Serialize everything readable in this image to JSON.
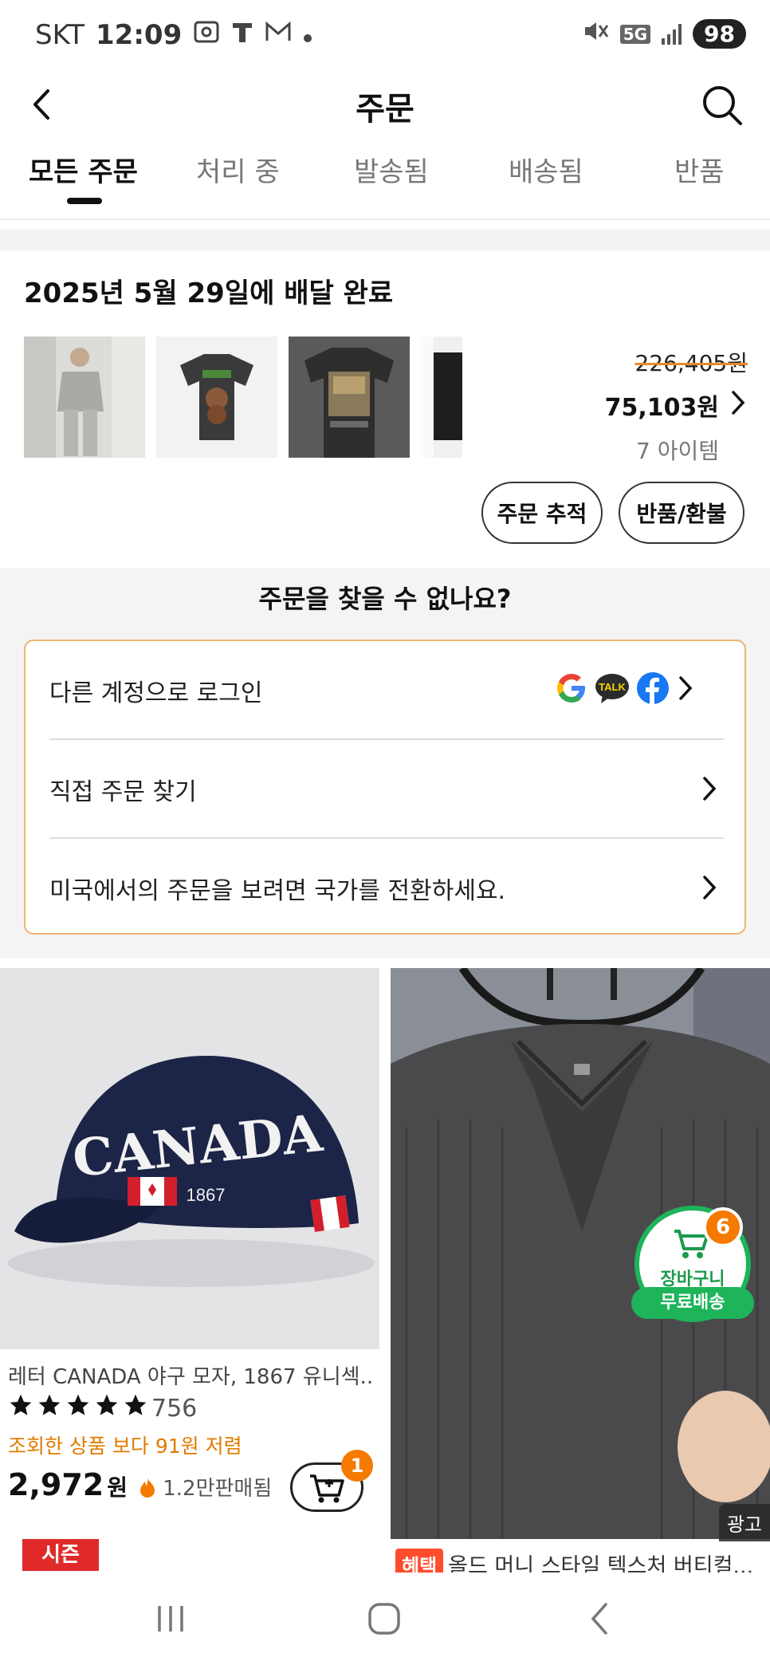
{
  "status_bar": {
    "carrier": "SKT",
    "time": "12:09",
    "network": "5G",
    "battery": "98"
  },
  "header": {
    "title": "주문"
  },
  "tabs": [
    {
      "label": "모든 주문",
      "active": true
    },
    {
      "label": "처리 중",
      "active": false
    },
    {
      "label": "발송됨",
      "active": false
    },
    {
      "label": "배송됨",
      "active": false
    },
    {
      "label": "반품",
      "active": false
    }
  ],
  "order": {
    "delivery_status": "2025년 5월 29일에 배달 완료",
    "original_price": "226,405원",
    "price": "75,103원",
    "item_count": "7 아이템",
    "track_button": "주문 추적",
    "return_button": "반품/환불"
  },
  "find_order": {
    "title": "주문을 찾을 수 없나요?",
    "rows": [
      {
        "label": "다른 계정으로 로그인"
      },
      {
        "label": "직접 주문 찾기"
      },
      {
        "label": "미국에서의 주문을 보려면 국가를 전환하세요."
      }
    ],
    "kakao_label": "TALK"
  },
  "products": {
    "left": {
      "name": "레터 CANADA 야구 모자, 1867 유니섹...",
      "rating_count": "756",
      "promo": "조회한 상품 보다 91원 저렴",
      "price": "2,972",
      "currency": "원",
      "sold": "1.2만판매됨",
      "cart_badge": "1",
      "hat_text": "CANADA",
      "hat_year": "1867",
      "season_tag": "시즌"
    },
    "right": {
      "ad_label": "광고",
      "deal_tag": "혜택",
      "name": "올드 머니 스타일 텍스처 버티컬..."
    }
  },
  "floating_cart": {
    "label": "장바구니",
    "badge": "6",
    "free_shipping": "무료배송"
  },
  "colors": {
    "accent_orange": "#f47a00",
    "cart_green": "#1db45a",
    "find_box_border": "#f0b36e"
  }
}
